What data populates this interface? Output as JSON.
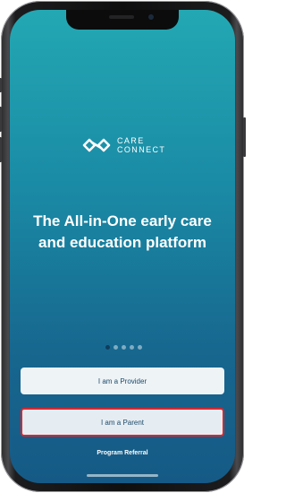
{
  "brand": {
    "line1": "CARE",
    "line2": "CONNECT"
  },
  "headline": {
    "line1": "The All-in-One early care",
    "line2": "and education platform"
  },
  "carousel": {
    "page_count": 5,
    "active_index": 0
  },
  "buttons": {
    "provider_label": "I am a Provider",
    "parent_label": "I am a Parent"
  },
  "links": {
    "program_referral": "Program Referral"
  },
  "colors": {
    "gradient_top": "#23a8b3",
    "gradient_bottom": "#155a86",
    "highlight_border": "#d7282f",
    "button_text": "#1d4a6a"
  },
  "icons": {
    "logo": "infinity-link-icon"
  }
}
